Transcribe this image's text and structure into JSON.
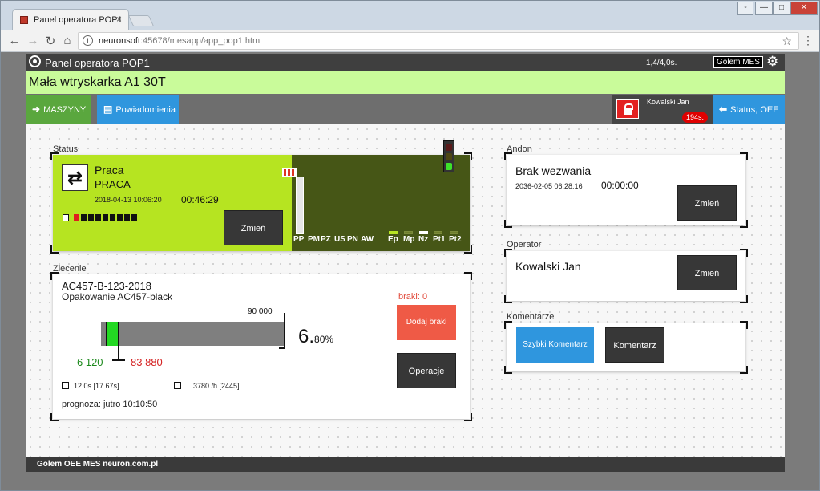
{
  "browser": {
    "tab_title": "Panel operatora POP1",
    "tab_close": "×",
    "url_host": "neuronsoft",
    "url_path": ":45678/mesapp/app_pop1.html",
    "info_glyph": "i",
    "controls": {
      "back": "←",
      "forward": "→",
      "reload": "↻",
      "home": "⌂",
      "star": "☆",
      "menu": "⋮"
    },
    "window": {
      "min": "—",
      "max": "□",
      "close": "✕",
      "user": "◦"
    }
  },
  "header": {
    "title": "Panel operatora POP1",
    "cycle_info": "1,4/4,0s.",
    "brand": "Golem MES",
    "settings_glyph": "⚙"
  },
  "machine": {
    "name": "Mała wtryskarka A1 30T"
  },
  "nav": {
    "machines_label": "MASZYNY",
    "notifications_label": "Powiadomienia",
    "user_name": "Kowalski Jan",
    "user_timer": "194s.",
    "status_label": "Status, OEE",
    "arrow_right": "➜",
    "arrow_left": "⬅",
    "notif_glyph": "▤"
  },
  "status": {
    "section_label": "Status",
    "state": "Praca",
    "state_code": "PRACA",
    "since": "2018-04-13 10:06:20",
    "duration": "00:46:29",
    "change_label": "Zmień",
    "cycle_glyph": "⇄",
    "cell_count": 9,
    "red_cell_index": 0,
    "downtime_codes": [
      "PP",
      "PM",
      "PZ",
      "US",
      "PN",
      "AW"
    ],
    "flag_codes": [
      "Ep",
      "Mp",
      "Nz",
      "Pt1",
      "Pt2"
    ],
    "flag_states": [
      "green",
      "off",
      "white",
      "off",
      "off"
    ],
    "bar_fill": 1.0,
    "traffic_light": {
      "red": "off",
      "yellow": "off",
      "green": "on"
    },
    "colors": {
      "active": "#b6e421",
      "panel_dark": "#465616"
    }
  },
  "order": {
    "section_label": "Zlecenie",
    "id": "AC457-B-123-2018",
    "description": "Opakowanie AC457-black",
    "target": "90 000",
    "done": "6 120",
    "remaining": "83 880",
    "percent_int": "6.",
    "percent_dec": "80%",
    "progress": 0.068,
    "cycle_time": "12.0s [17.67s]",
    "rate": "3780 /h [2445]",
    "forecast": "prognoza: jutro 10:10:50",
    "scrap": "braki: 0",
    "add_scrap_label": "Dodaj braki",
    "operations_label": "Operacje"
  },
  "andon": {
    "section_label": "Andon",
    "state": "Brak wezwania",
    "date": "2036-02-05 06:28:16",
    "timer": "00:00:00",
    "change_label": "Zmień"
  },
  "operator": {
    "section_label": "Operator",
    "name": "Kowalski Jan",
    "change_label": "Zmień"
  },
  "comments": {
    "section_label": "Komentarze",
    "quick_label": "Szybki Komentarz",
    "comment_label": "Komentarz"
  },
  "footer": {
    "text": "Golem OEE MES neuron.com.pl"
  }
}
